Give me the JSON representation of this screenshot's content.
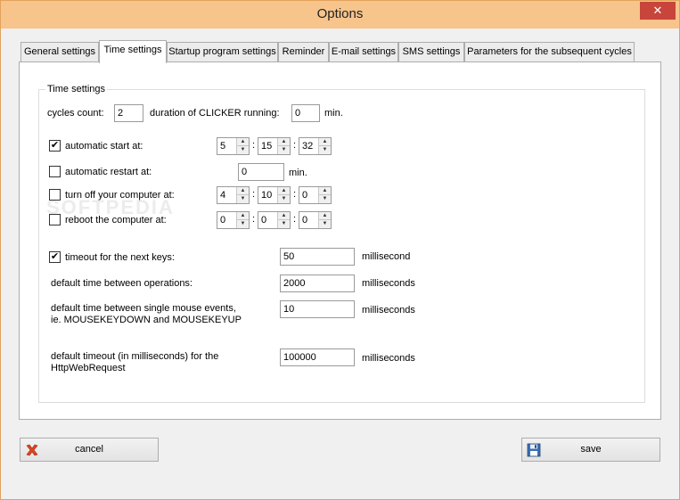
{
  "window": {
    "title": "Options",
    "close_glyph": "✕"
  },
  "tabs": [
    {
      "label": "General settings"
    },
    {
      "label": "Time settings"
    },
    {
      "label": "Startup program settings"
    },
    {
      "label": "Reminder"
    },
    {
      "label": "E-mail settings"
    },
    {
      "label": "SMS settings"
    },
    {
      "label": "Parameters for the subsequent cycles"
    }
  ],
  "active_tab": "Time settings",
  "group": {
    "legend": "Time settings"
  },
  "cycles": {
    "count_label": "cycles count:",
    "count_value": "2",
    "duration_label": "duration of CLICKER running:",
    "duration_value": "0",
    "duration_unit": "min."
  },
  "auto_start": {
    "label": "automatic start at:",
    "checked": true,
    "check_glyph": "✔",
    "h": "5",
    "m": "15",
    "s": "32"
  },
  "auto_restart": {
    "label": "automatic restart at:",
    "checked": false,
    "value": "0",
    "unit": "min."
  },
  "turn_off": {
    "label": "turn off your computer at:",
    "checked": false,
    "h": "4",
    "m": "10",
    "s": "0"
  },
  "reboot": {
    "label": "reboot the computer at:",
    "checked": false,
    "h": "0",
    "m": "0",
    "s": "0"
  },
  "timeout_keys": {
    "label": "timeout for the next keys:",
    "checked": true,
    "check_glyph": "✔",
    "value": "50",
    "unit": "millisecond"
  },
  "default_ops": {
    "label": "default time between operations:",
    "value": "2000",
    "unit": "milliseconds"
  },
  "default_mouse": {
    "label": "default time between single mouse events, ie. MOUSEKEYDOWN and MOUSEKEYUP",
    "value": "10",
    "unit": "milliseconds"
  },
  "default_http": {
    "label": "default timeout (in milliseconds) for the HttpWebRequest",
    "value": "100000",
    "unit": "milliseconds"
  },
  "time_sep": ":",
  "spin_up_glyph": "▲",
  "spin_down_glyph": "▼",
  "buttons": {
    "cancel": "cancel",
    "save": "save"
  },
  "watermark": "SOFTPEDIA",
  "icons": {
    "cancel": "red-x-icon",
    "save": "floppy-disk-icon",
    "spin": "spinner-arrows-icon"
  },
  "colors": {
    "titlebar": "#f7c48c",
    "cancel_icon": "#e0431f",
    "save_icon": "#3c6fb0"
  }
}
